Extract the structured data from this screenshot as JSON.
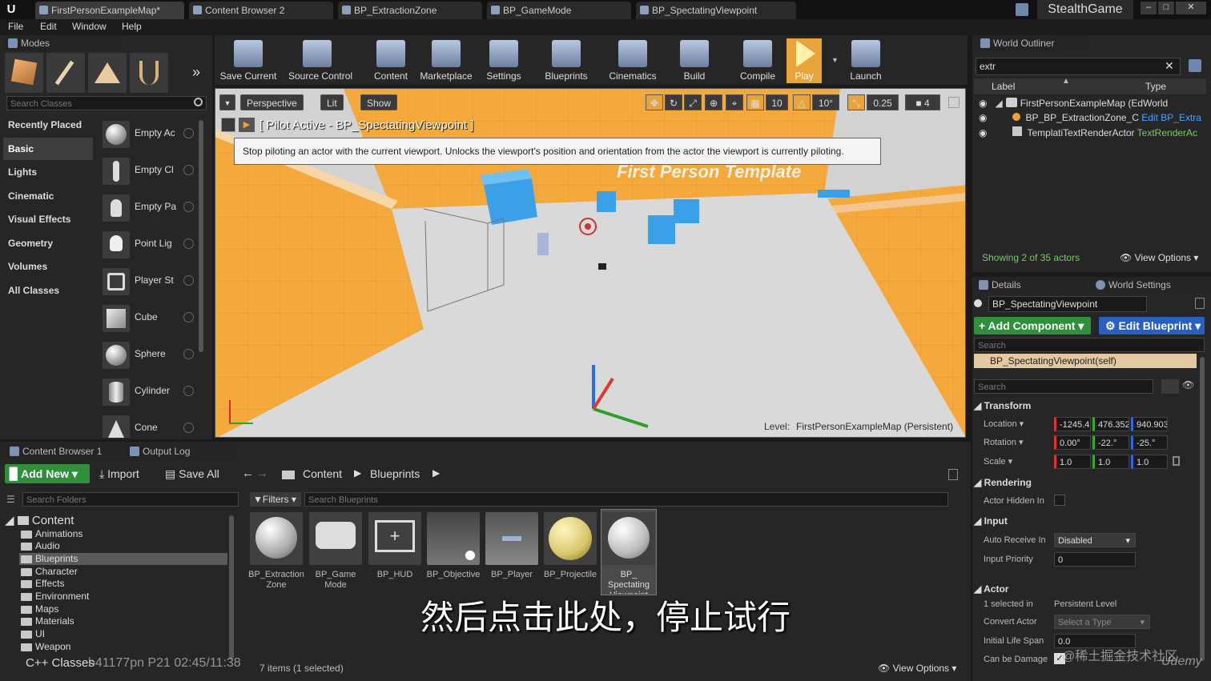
{
  "tabs": [
    "FirstPersonExampleMap*",
    "Content Browser 2",
    "BP_ExtractionZone",
    "BP_GameMode",
    "BP_SpectatingViewpoint"
  ],
  "project_name": "StealthGame",
  "menu": [
    "File",
    "Edit",
    "Window",
    "Help"
  ],
  "modes": {
    "title": "Modes",
    "search_placeholder": "Search Classes",
    "categories": [
      "Recently Placed",
      "Basic",
      "Lights",
      "Cinematic",
      "Visual Effects",
      "Geometry",
      "Volumes",
      "All Classes"
    ],
    "items": [
      "Empty Ac",
      "Empty Cl",
      "Empty Pa",
      "Point Lig",
      "Player St",
      "Cube",
      "Sphere",
      "Cylinder",
      "Cone"
    ]
  },
  "toolbar": [
    "Save Current",
    "Source Control",
    "Content",
    "Marketplace",
    "Settings",
    "Blueprints",
    "Cinematics",
    "Build",
    "Compile",
    "Play",
    "Launch"
  ],
  "viewport": {
    "perspective": "Perspective",
    "lit": "Lit",
    "show": "Show",
    "snap_grid": "10",
    "snap_rot": "10°",
    "snap_scale": "0.25",
    "camera_speed": "4",
    "pilot_label": "[ Pilot Active - BP_SpectatingViewpoint ]",
    "tooltip": "Stop piloting an actor with the current viewport. Unlocks the viewport's position and orientation from the actor the viewport is currently piloting.",
    "level_label": "Level:",
    "level_name": "FirstPersonExampleMap (Persistent)",
    "wall_text": "First Person Template"
  },
  "outliner": {
    "title": "World Outliner",
    "search_value": "extr",
    "col_label": "Label",
    "col_type": "Type",
    "rows": [
      {
        "label": "FirstPersonExampleMap (EdWorld",
        "type": ""
      },
      {
        "label": "BP_BP_ExtractionZone_C",
        "type": "Edit BP_Extra"
      },
      {
        "label": "TemplatiTextRenderActor",
        "type": "TextRenderAc"
      }
    ],
    "showing": "Showing 2 of 35 actors",
    "view_options": "View Options"
  },
  "details": {
    "tab_details": "Details",
    "tab_world": "World Settings",
    "actor_name": "BP_SpectatingViewpoint",
    "add_component": "+ Add Component",
    "edit_blueprint": "Edit Blueprint",
    "search1": "Search",
    "self_item": "BP_SpectatingViewpoint(self)",
    "search2": "Search",
    "transform": "Transform",
    "location": "Location",
    "loc": [
      "-1245.4",
      "476.352",
      "940.903"
    ],
    "rotation": "Rotation",
    "rot": [
      "0.00°",
      "-22.°",
      "-25.°"
    ],
    "scale": "Scale",
    "scl": [
      "1.0",
      "1.0",
      "1.0"
    ],
    "rendering": "Rendering",
    "actor_hidden": "Actor Hidden In",
    "input": "Input",
    "auto_receive": "Auto Receive In",
    "auto_receive_val": "Disabled",
    "input_priority": "Input Priority",
    "input_priority_val": "0",
    "actor": "Actor",
    "selected_in": "1 selected in",
    "persistent_level": "Persistent Level",
    "convert_actor": "Convert Actor",
    "select_type": "Select a Type",
    "initial_life": "Initial Life Span",
    "initial_life_val": "0.0",
    "can_be_damaged": "Can be Damage"
  },
  "content_browser": {
    "tab1": "Content Browser 1",
    "tab2": "Output Log",
    "add_new": "Add New",
    "import": "Import",
    "save_all": "Save All",
    "crumbs": [
      "Content",
      "Blueprints"
    ],
    "search_folders": "Search Folders",
    "filters": "Filters",
    "search_blueprints": "Search Blueprints",
    "tree_root": "Content",
    "folders": [
      "Animations",
      "Audio",
      "Blueprints",
      "Character",
      "Effects",
      "Environment",
      "Maps",
      "Materials",
      "UI",
      "Weapon"
    ],
    "cpp": "C++ Classes",
    "assets": [
      "BP_Extraction Zone",
      "BP_Game Mode",
      "BP_HUD",
      "BP_Objective",
      "BP_Player",
      "BP_Projectile",
      "BP_ Spectating Viewpoint"
    ],
    "items_count": "7 items (1 selected)",
    "view_options": "View Options"
  },
  "subtitle": "然后点击此处，停止试行",
  "watermark_left": "b41177pn P21 02:45/11:38",
  "watermark_right": "@稀土掘金技术社区",
  "watermark_udemy": "Udemy"
}
